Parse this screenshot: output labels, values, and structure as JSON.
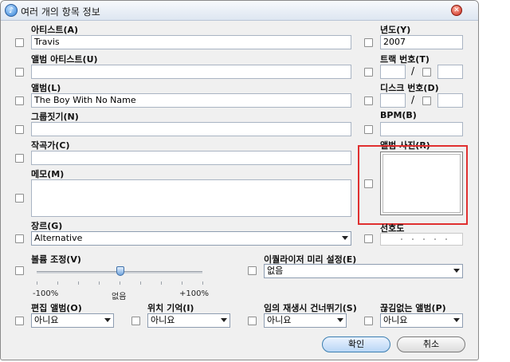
{
  "window": {
    "title": "여러 개의 항목 정보"
  },
  "labels": {
    "artist": "아티스트(A)",
    "year": "년도(Y)",
    "album_artist": "앨범 아티스트(U)",
    "track_number": "트랙 번호(T)",
    "album": "앨범(L)",
    "disc_number": "디스크 번호(D)",
    "grouping": "그룹짓기(N)",
    "bpm": "BPM(B)",
    "composer": "작곡가(C)",
    "artwork": "앨범 사진(R)",
    "comments": "메모(M)",
    "genre": "장르(G)",
    "rating": "선호도",
    "volume_adjustment": "볼륨 조정(V)",
    "equalizer_preset": "이퀄라이저 미리 설정(E)",
    "compilation": "편집 앨범(O)",
    "remember_position": "위치 기억(I)",
    "skip_shuffle": "임의 재생시 건너뛰기(S)",
    "gapless": "끊김없는 앨범(P)"
  },
  "values": {
    "artist": "Travis",
    "year": "2007",
    "album_artist": "",
    "track_number": "",
    "track_count": "",
    "album": "The Boy With No Name",
    "disc_number": "",
    "disc_count": "",
    "grouping": "",
    "bpm": "",
    "composer": "",
    "comments": "",
    "genre": "Alternative",
    "equalizer_preset": "없음",
    "compilation": "아니요",
    "remember_position": "아니요",
    "skip_shuffle": "아니요",
    "gapless": "아니요",
    "volume_adjustment_percent": 0
  },
  "slider": {
    "min_label": "-100%",
    "mid_label": "없음",
    "max_label": "+100%"
  },
  "track_separator": "/",
  "disc_separator": "/",
  "buttons": {
    "ok": "확인",
    "cancel": "취소"
  },
  "icons": {
    "app": "itunes-icon",
    "close": "close-icon",
    "dropdown": "chevron-down-icon"
  },
  "colors": {
    "highlight": "#e03030",
    "ok_button_border": "#3c7fb1"
  }
}
